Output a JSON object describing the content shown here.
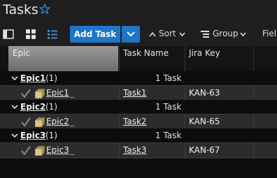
{
  "header": {
    "title": "Tasks",
    "star_icon": "star-outline-icon",
    "accent": "#1d76c8"
  },
  "toolbar": {
    "view_icons": [
      "panel-view-icon",
      "grid-view-icon",
      "list-view-icon"
    ],
    "add_task_label": "Add Task",
    "sort_label": "Sort",
    "group_label": "Group",
    "fields_label": "Fiel"
  },
  "columns": {
    "epic": "Epic",
    "task_name": "Task Name",
    "jira_key": "Jira Key"
  },
  "groups": [
    {
      "epic": "Epic1",
      "count": "(1)",
      "summary": "1 Task",
      "row": {
        "epic": "Epic1",
        "mark": "_",
        "task": "Task1",
        "key": "KAN-63"
      }
    },
    {
      "epic": "Epic2",
      "count": "(1)",
      "summary": "1 Task",
      "row": {
        "epic": "Epic2",
        "mark": "_",
        "task": "Task2",
        "key": "KAN-65"
      }
    },
    {
      "epic": "Epic3",
      "count": "(1)",
      "summary": "1 Task",
      "row": {
        "epic": "Epic3",
        "mark": "_",
        "task": "Task3",
        "key": "KAN-67"
      }
    }
  ]
}
